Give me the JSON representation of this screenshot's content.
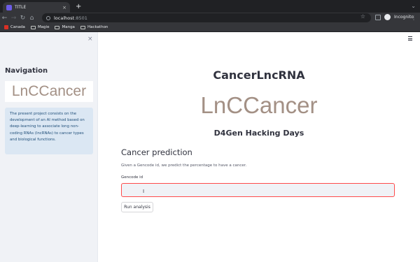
{
  "browser": {
    "tab_title": "TITLE",
    "new_tab": "+",
    "url_host": "localhost",
    "url_port": ":8501",
    "profile_label": "Incognito",
    "bookmarks": [
      {
        "label": "Canada",
        "icon": "flag-icon"
      },
      {
        "label": "Magie",
        "icon": "folder-icon"
      },
      {
        "label": "Manga",
        "icon": "folder-icon"
      },
      {
        "label": "Hackathon",
        "icon": "folder-icon"
      }
    ]
  },
  "sidebar": {
    "close_glyph": "×",
    "title": "Navigation",
    "logo_text": "LnCCancer",
    "info_text": "The present project consists on the development of an AI method based on deep-learning to associate long non-coding RNAs (lncRNAs) to cancer types and biological functions."
  },
  "main": {
    "title": "CancerLncRNA",
    "logo_text": "LnCCancer",
    "subtitle": "D4Gen Hacking Days",
    "section_title": "Cancer prediction",
    "description": "Given a Gencode id, we predict the percentage to have a cancer.",
    "field_label": "Gencode id",
    "field_value": "",
    "button_label": "Run analysis"
  },
  "colors": {
    "accent": "#ff4b4b",
    "sidebar_bg": "#f0f2f6",
    "info_bg": "#dbe7f3",
    "logo": "#a39085"
  }
}
